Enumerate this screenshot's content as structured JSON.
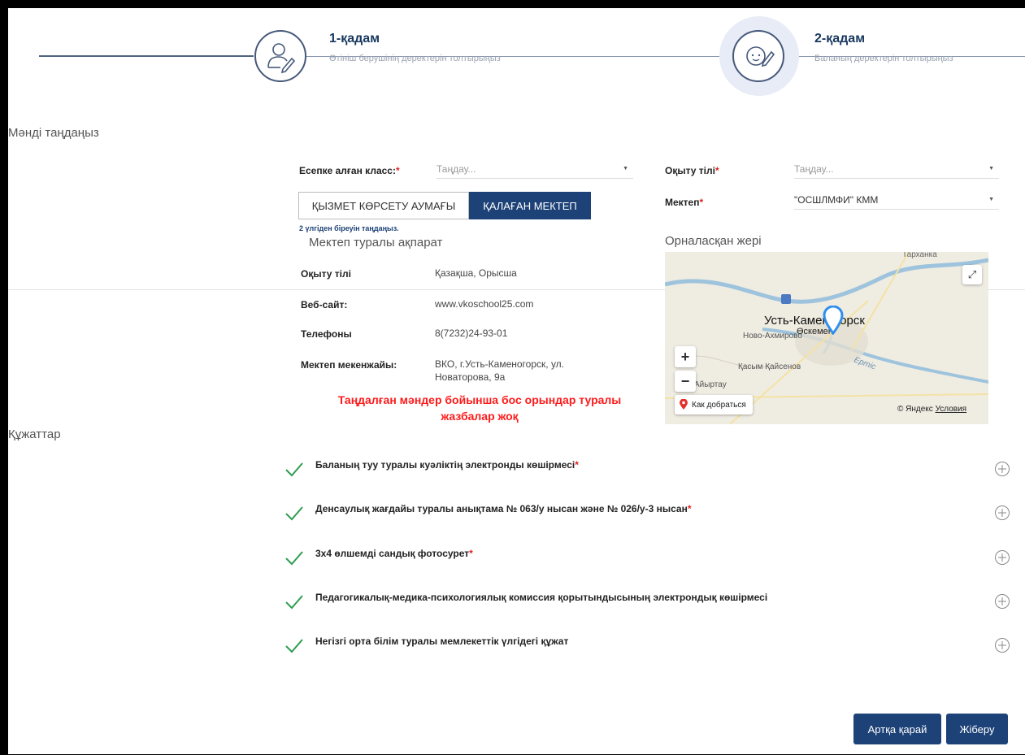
{
  "stepper": {
    "step1_title": "1-қадам",
    "step1_sub": "Өтініш берушінің деректерін толтырыңыз",
    "step2_title": "2-қадам",
    "step2_sub": "Баланың деректерін толтырыңыз"
  },
  "select_section": {
    "title": "Мәнді таңдаңыз",
    "class_label": "Есепке алған класс:",
    "class_placeholder": "Таңдау...",
    "lang_label": "Оқыту тілі",
    "lang_placeholder": "Таңдау...",
    "school_label": "Мектеп",
    "school_value": "\"ОСШЛМФИ\" КММ",
    "tab_service": "ҚЫЗМЕТ КӨРСЕТУ АУМАҒЫ",
    "tab_preferred": "ҚАЛАҒАН МЕКТЕП",
    "hint": "2 үлгіден біреуін таңдаңыз."
  },
  "school_info": {
    "title": "Мектеп туралы ақпарат",
    "rows": [
      {
        "key": "Оқыту тілі",
        "value": "Қазақша, Орысша"
      },
      {
        "key": "Веб-сайт:",
        "value": "www.vkoschool25.com"
      },
      {
        "key": "Телефоны",
        "value": "8(7232)24-93-01"
      },
      {
        "key": "Мектеп мекенжайы:",
        "value": "ВКО, г.Усть-Каменогорск, ул. Новаторова, 9а"
      }
    ],
    "warning": "Таңдалған мәндер бойынша бос орындар туралы жазбалар жоқ"
  },
  "location": {
    "title": "Орналасқан жері",
    "map_city": "Усть-Каменогорск",
    "map_place1": "Ново-Ахмирово",
    "map_place2": "Өскемен",
    "map_place3": "Қасым Қайсенов",
    "map_place4": "Тарханка",
    "map_place5": "Айыртау",
    "map_river": "Ертіс",
    "route_label": "Как добраться",
    "copyright": "© Яндекс",
    "terms": "Условия",
    "zoom_in": "+",
    "zoom_out": "−"
  },
  "documents": {
    "title": "Құжаттар",
    "items": [
      {
        "label": "Баланың туу туралы куәліктің электронды көшірмесі",
        "required": "*"
      },
      {
        "label": "Денсаулық жағдайы туралы анықтама № 063/у нысан және № 026/у-3 нысан",
        "required": "*"
      },
      {
        "label": "3х4 өлшемді сандық фотосурет",
        "required": "*"
      },
      {
        "label": "Педагогикалық-медика-психологиялық комиссия қорытындысының электрондық көшірмесі",
        "required": ""
      },
      {
        "label": "Негізгі орта білім туралы мемлекеттік үлгідегі құжат",
        "required": ""
      }
    ]
  },
  "footer": {
    "back": "Артқа қарай",
    "submit": "Жіберу"
  },
  "colors": {
    "primary": "#1d4277",
    "required": "#e02020",
    "check": "#2e9e4f",
    "warning": "#ff1a1a"
  }
}
